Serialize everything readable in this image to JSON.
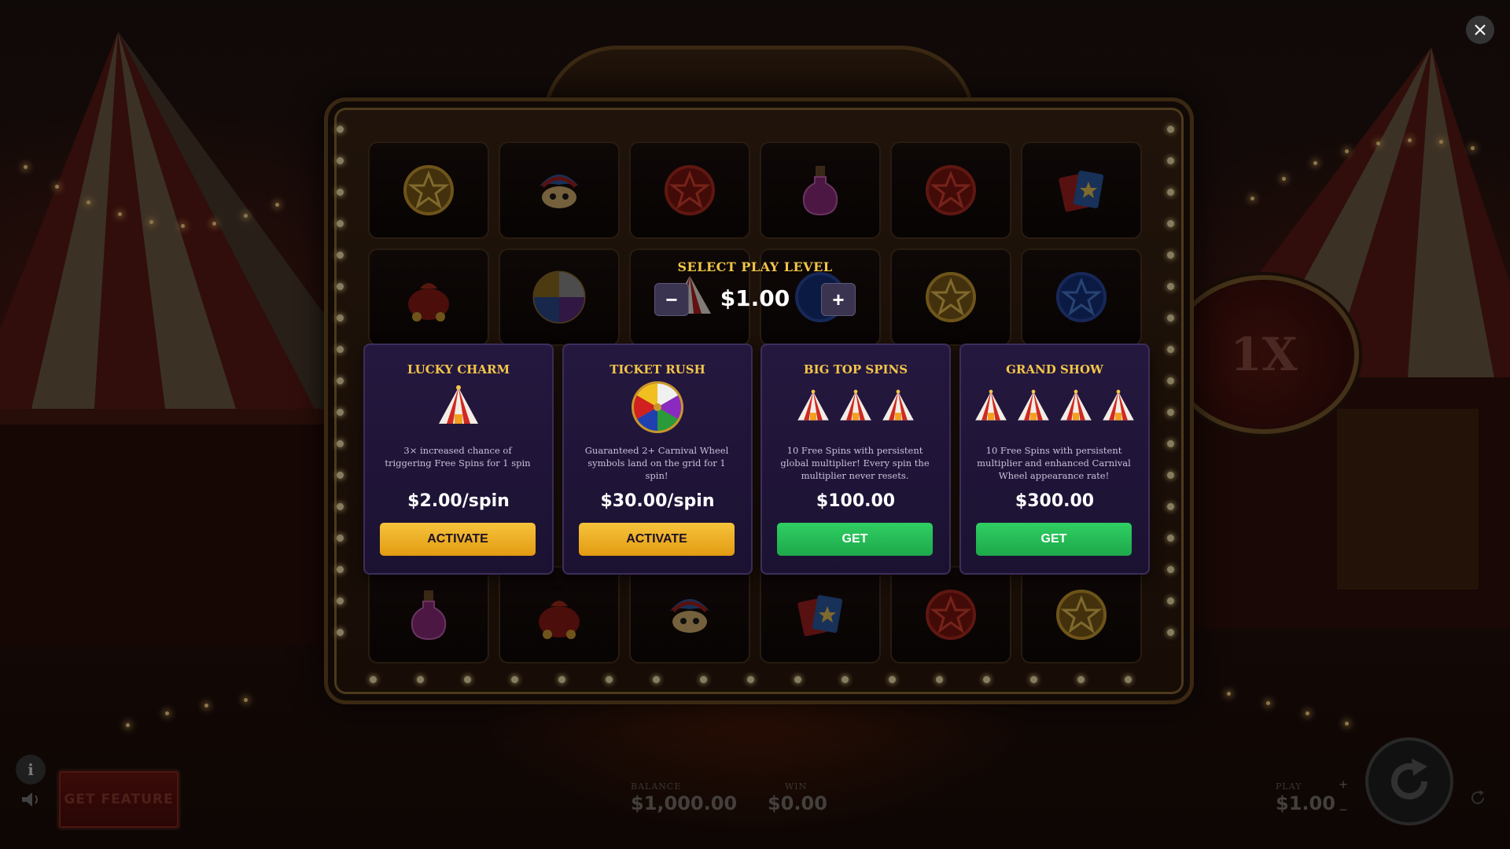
{
  "play_level": {
    "title": "SELECT PLAY LEVEL",
    "value": "$1.00",
    "minus": "−",
    "plus": "+"
  },
  "cards": [
    {
      "title": "LUCKY CHARM",
      "icon": "circus-tent-icon",
      "icon_count": 1,
      "description": "3× increased chance of triggering Free Spins for 1 spin",
      "price": "$2.00/spin",
      "button": "ACTIVATE",
      "button_color": "#f0b125"
    },
    {
      "title": "TICKET RUSH",
      "icon": "carnival-wheel-icon",
      "icon_count": 1,
      "description": "Guaranteed 2+ Carnival Wheel symbols land on the grid for 1 spin!",
      "price": "$30.00/spin",
      "button": "ACTIVATE",
      "button_color": "#f0b125"
    },
    {
      "title": "BIG TOP SPINS",
      "icon": "circus-tent-icon",
      "icon_count": 3,
      "description": "10 Free Spins with persistent global multiplier! Every spin the multiplier never resets.",
      "price": "$100.00",
      "button": "GET",
      "button_color": "#27bd57"
    },
    {
      "title": "GRAND SHOW",
      "icon": "circus-tent-icon",
      "icon_count": 4,
      "description": "10 Free Spins with persistent multiplier and enhanced Carnival Wheel appearance rate!",
      "price": "$300.00",
      "button": "GET",
      "button_color": "#27bd57"
    }
  ],
  "multiplier": "1X",
  "get_feature": "GET FEATURE",
  "info_label": "i",
  "balance": {
    "label": "BALANCE",
    "value": "$1,000.00"
  },
  "win": {
    "label": "WIN",
    "value": "$0.00"
  },
  "play": {
    "label": "PLAY",
    "value": "$1.00",
    "plus": "+",
    "minus": "−"
  },
  "colors": {
    "accent_gold": "#f3c64a",
    "card_bg": "#25183f",
    "activate": "#f0b125",
    "get": "#27bd57"
  }
}
